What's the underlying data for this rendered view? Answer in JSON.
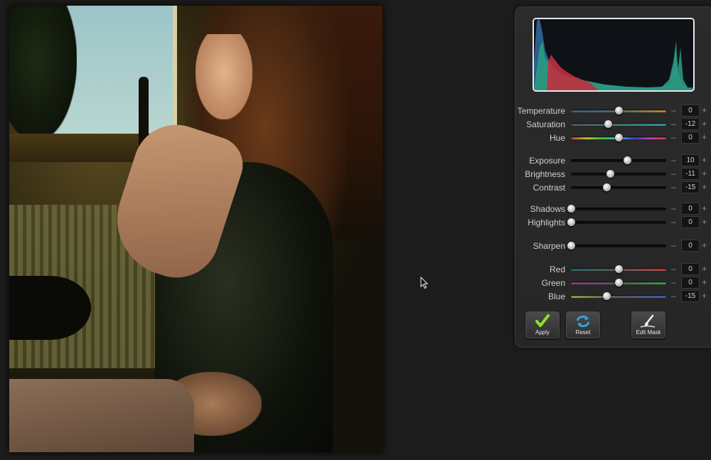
{
  "adjustments": [
    {
      "label": "Temperature",
      "value": "0",
      "position": 0.5,
      "track": "temp"
    },
    {
      "label": "Saturation",
      "value": "-12",
      "position": 0.39,
      "track": "sat"
    },
    {
      "label": "Hue",
      "value": "0",
      "position": 0.5,
      "track": "hue"
    },
    {
      "label": "Exposure",
      "value": "10",
      "position": 0.59,
      "track": "plain"
    },
    {
      "label": "Brightness",
      "value": "-11",
      "position": 0.41,
      "track": "plain"
    },
    {
      "label": "Contrast",
      "value": "-15",
      "position": 0.37,
      "track": "plain"
    },
    {
      "label": "Shadows",
      "value": "0",
      "position": 0.0,
      "track": "plain"
    },
    {
      "label": "Highlights",
      "value": "0",
      "position": 0.0,
      "track": "plain"
    },
    {
      "label": "Sharpen",
      "value": "0",
      "position": 0.0,
      "track": "plain"
    },
    {
      "label": "Red",
      "value": "0",
      "position": 0.5,
      "track": "red"
    },
    {
      "label": "Green",
      "value": "0",
      "position": 0.5,
      "track": "green"
    },
    {
      "label": "Blue",
      "value": "-15",
      "position": 0.37,
      "track": "blue"
    }
  ],
  "stepper": {
    "minus": "–",
    "plus": "+"
  },
  "buttons": {
    "apply": "Apply",
    "reset": "Reset",
    "edit_mask": "Edit Mask"
  },
  "colors": {
    "panel_bg": "#282828",
    "apply_check": "#8ee02a",
    "reset_arrows": "#2aa7e0",
    "histogram_blue": "#2a6a9a",
    "histogram_green": "#2aa080",
    "histogram_red": "#c03040"
  },
  "icons": {
    "apply": "checkmark-icon",
    "reset": "refresh-icon",
    "edit_mask": "brush-icon",
    "cursor": "mouse-pointer-icon"
  }
}
